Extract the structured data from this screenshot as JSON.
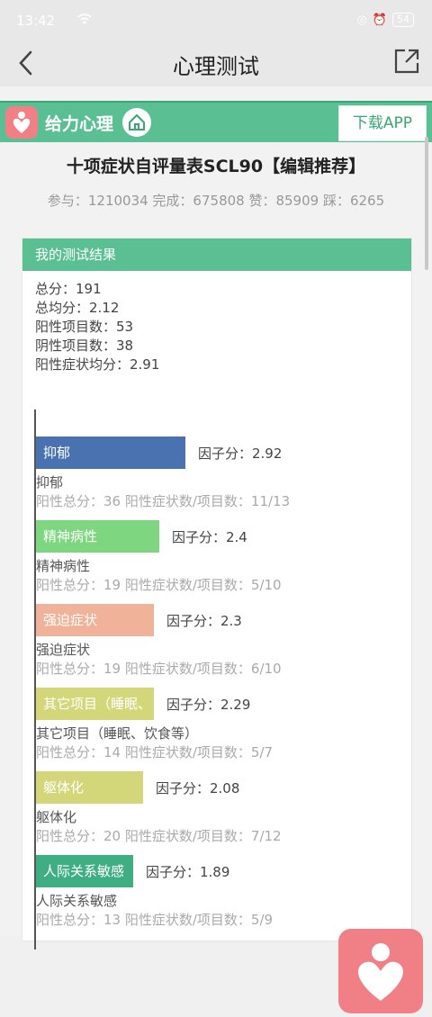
{
  "status_bar": {
    "time": "13:42",
    "battery": "54"
  },
  "nav": {
    "title": "心理测试"
  },
  "brand": {
    "name": "给力心理",
    "download_label": "下载APP"
  },
  "test": {
    "title": "十项症状自评量表SCL90【编辑推荐】",
    "stats": "参与：1210034 完成：675808 赞：85909 踩：6265"
  },
  "result_card": {
    "header": "我的测试结果",
    "summary": [
      "总分：191",
      "总均分：2.12",
      "阳性项目数：53",
      "阴性项目数：38",
      "阳性症状均分：2.91"
    ]
  },
  "chart_data": {
    "type": "bar",
    "orientation": "horizontal",
    "value_label_prefix": "因子分：",
    "categories": [
      {
        "bar_label": "抑郁",
        "name": "抑郁",
        "value": 2.92,
        "value_text": "2.92",
        "color": "#4a72b0",
        "detail": "阳性总分：36   阳性症状数/项目数：11/13"
      },
      {
        "bar_label": "精神病性",
        "name": "精神病性",
        "value": 2.4,
        "value_text": "2.4",
        "color": "#7fd681",
        "detail": "阳性总分：19   阳性症状数/项目数：5/10"
      },
      {
        "bar_label": "强迫症状",
        "name": "强迫症状",
        "value": 2.3,
        "value_text": "2.3",
        "color": "#f0b39a",
        "detail": "阳性总分：19   阳性症状数/项目数：6/10"
      },
      {
        "bar_label": "其它项目（睡眠、",
        "name": "其它项目（睡眠、饮食等）",
        "value": 2.29,
        "value_text": "2.29",
        "color": "#d3d77a",
        "detail": "阳性总分：14   阳性症状数/项目数：5/7"
      },
      {
        "bar_label": "躯体化",
        "name": "躯体化",
        "value": 2.08,
        "value_text": "2.08",
        "color": "#d3d77a",
        "detail": "阳性总分：20   阳性症状数/项目数：7/12"
      },
      {
        "bar_label": "人际关系敏感",
        "name": "人际关系敏感",
        "value": 1.89,
        "value_text": "1.89",
        "color": "#3fae82",
        "detail": "阳性总分：13   阳性症状数/项目数：5/9"
      }
    ]
  }
}
